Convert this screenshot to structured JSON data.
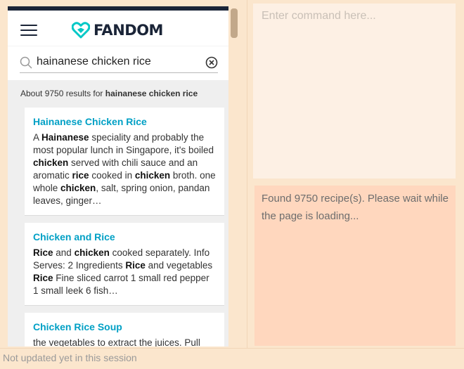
{
  "fandom": {
    "logo_text": "FANDOM",
    "brand_color": "#00c8c6"
  },
  "search": {
    "value": "hainanese chicken rice",
    "placeholder": ""
  },
  "results": {
    "summary_prefix": "About 9750 results for ",
    "summary_query": "hainanese chicken rice",
    "items": [
      {
        "title": "Hainanese Chicken Rice",
        "snippet_parts": [
          {
            "t": "A "
          },
          {
            "t": "Hainanese",
            "b": true
          },
          {
            "t": " speciality and probably the most popular lunch in Singapore, it's boiled "
          },
          {
            "t": "chicken",
            "b": true
          },
          {
            "t": " served with chili sauce and an aromatic "
          },
          {
            "t": "rice",
            "b": true
          },
          {
            "t": " cooked in "
          },
          {
            "t": "chicken",
            "b": true
          },
          {
            "t": " broth. one whole "
          },
          {
            "t": "chicken",
            "b": true
          },
          {
            "t": ", salt, spring onion, pandan leaves, ginger…"
          }
        ]
      },
      {
        "title": "Chicken and Rice",
        "snippet_parts": [
          {
            "t": "Rice",
            "b": true
          },
          {
            "t": " and "
          },
          {
            "t": "chicken",
            "b": true
          },
          {
            "t": " cooked separately. Info Serves: 2 Ingredients "
          },
          {
            "t": "Rice",
            "b": true
          },
          {
            "t": " and vegetables "
          },
          {
            "t": "Rice",
            "b": true
          },
          {
            "t": " Fine sliced carrot 1 small red pepper 1 small leek 6 fish…"
          }
        ]
      },
      {
        "title": "Chicken Rice Soup",
        "snippet_parts": [
          {
            "t": "the vegetables to extract the juices. Pull"
          }
        ]
      }
    ]
  },
  "command": {
    "placeholder": "Enter command here...",
    "value": ""
  },
  "status_panel": {
    "message": "Found 9750 recipe(s). Please wait while the page is loading..."
  },
  "footer": {
    "status": "Not updated yet in this session"
  }
}
